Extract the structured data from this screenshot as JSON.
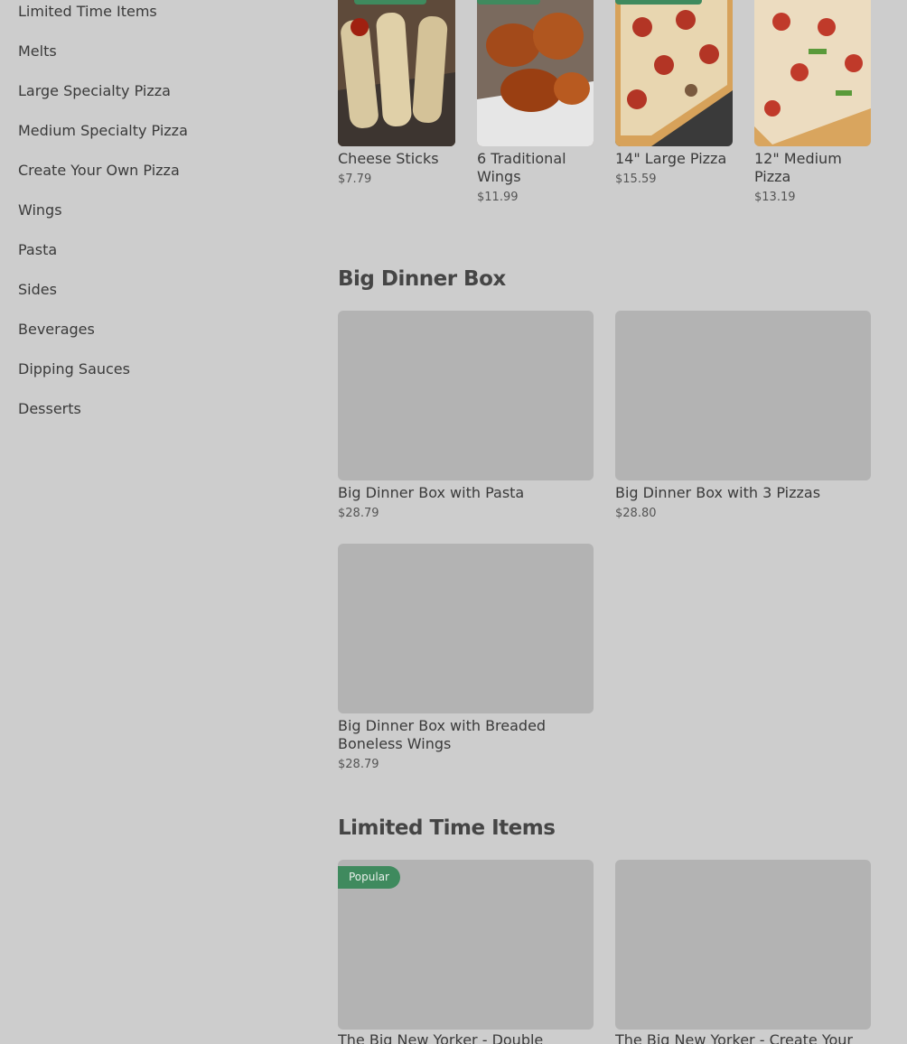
{
  "sidebar": {
    "items": [
      {
        "label": "Limited Time Items"
      },
      {
        "label": "Melts"
      },
      {
        "label": "Large Specialty Pizza"
      },
      {
        "label": "Medium Specialty Pizza"
      },
      {
        "label": "Create Your Own Pizza"
      },
      {
        "label": "Wings"
      },
      {
        "label": "Pasta"
      },
      {
        "label": "Sides"
      },
      {
        "label": "Beverages"
      },
      {
        "label": "Dipping Sauces"
      },
      {
        "label": "Desserts"
      }
    ]
  },
  "popular_row": {
    "items": [
      {
        "name": "Cheese Sticks",
        "price": "$7.79"
      },
      {
        "name": "6 Traditional Wings",
        "price": "$11.99"
      },
      {
        "name": "14\" Large Pizza",
        "price": "$15.59"
      },
      {
        "name": "12\" Medium Pizza",
        "price": "$13.19"
      }
    ]
  },
  "big_dinner_box": {
    "title": "Big Dinner Box",
    "items": [
      {
        "name": "Big Dinner Box with Pasta",
        "price": "$28.79"
      },
      {
        "name": "Big Dinner Box with 3 Pizzas",
        "price": "$28.80"
      },
      {
        "name": "Big Dinner Box with Breaded Boneless Wings",
        "price": "$28.79"
      }
    ]
  },
  "limited_time": {
    "title": "Limited Time Items",
    "badge": "Popular",
    "items": [
      {
        "name": "The Big New Yorker - Double"
      },
      {
        "name": "The Big New Yorker - Create Your"
      }
    ]
  },
  "colors": {
    "accent": "#3f8a5e",
    "overlay_bg": "#cdcdcd",
    "placeholder": "#b3b3b3"
  }
}
